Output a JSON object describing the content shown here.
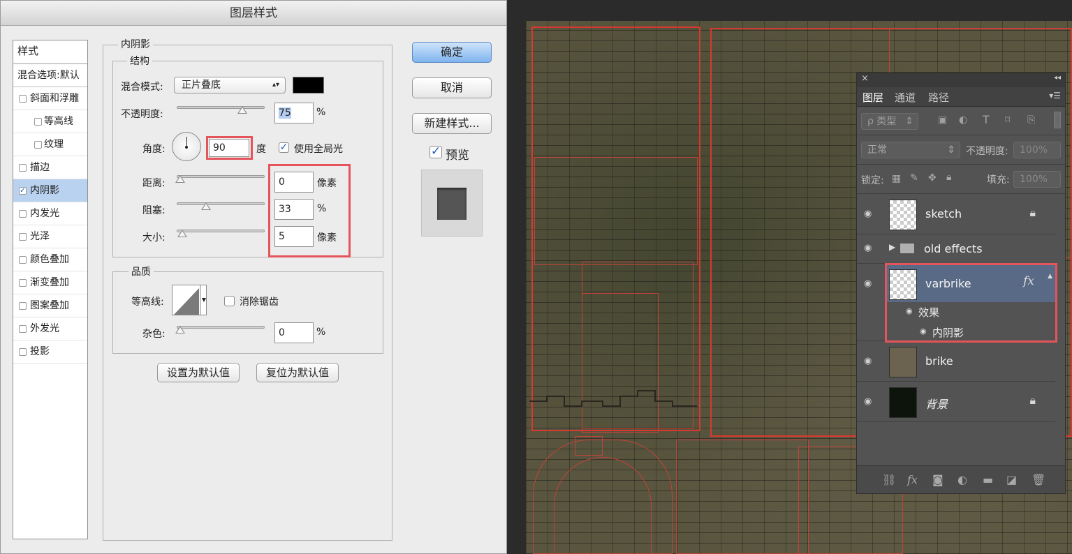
{
  "dialog": {
    "title": "图层样式",
    "style_list": {
      "header": "样式",
      "blend": "混合选项:默认",
      "items": [
        {
          "label": "斜面和浮雕",
          "checked": false,
          "sub": false
        },
        {
          "label": "等高线",
          "checked": false,
          "sub": true
        },
        {
          "label": "纹理",
          "checked": false,
          "sub": true
        },
        {
          "label": "描边",
          "checked": false,
          "sub": false
        },
        {
          "label": "内阴影",
          "checked": true,
          "sub": false
        },
        {
          "label": "内发光",
          "checked": false,
          "sub": false
        },
        {
          "label": "光泽",
          "checked": false,
          "sub": false
        },
        {
          "label": "颜色叠加",
          "checked": false,
          "sub": false
        },
        {
          "label": "渐变叠加",
          "checked": false,
          "sub": false
        },
        {
          "label": "图案叠加",
          "checked": false,
          "sub": false
        },
        {
          "label": "外发光",
          "checked": false,
          "sub": false
        },
        {
          "label": "投影",
          "checked": false,
          "sub": false
        }
      ]
    },
    "inner_shadow": {
      "title": "内阴影",
      "structure": {
        "title": "结构",
        "blend_mode_label": "混合模式:",
        "blend_mode_value": "正片叠底",
        "shadow_color": "#000000",
        "opacity_label": "不透明度:",
        "opacity_value": "75",
        "opacity_unit": "%",
        "opacity_fraction": 0.75,
        "angle_label": "角度:",
        "angle_value": "90",
        "angle_unit": "度",
        "global_light_label": "使用全局光",
        "global_light_checked": true,
        "distance_label": "距离:",
        "distance_value": "0",
        "distance_unit": "像素",
        "choke_label": "阻塞:",
        "choke_value": "33",
        "choke_unit": "%",
        "choke_fraction": 0.33,
        "size_label": "大小:",
        "size_value": "5",
        "size_unit": "像素"
      },
      "quality": {
        "title": "品质",
        "contour_label": "等高线:",
        "antialias_label": "消除锯齿",
        "antialias_checked": false,
        "noise_label": "杂色:",
        "noise_value": "0",
        "noise_unit": "%"
      },
      "set_default": "设置为默认值",
      "reset_default": "复位为默认值"
    },
    "buttons": {
      "ok": "确定",
      "cancel": "取消",
      "new_style": "新建样式...",
      "preview": "预览",
      "preview_checked": true
    }
  },
  "layers_panel": {
    "close_glyph": "×",
    "collapse_glyph": "◂◂",
    "tabs": [
      "图层",
      "通道",
      "路径"
    ],
    "menu_glyph": "▾☰",
    "filter_label": "ρ 类型",
    "blend_mode": "正常",
    "opacity_label": "不透明度:",
    "opacity_value": "100%",
    "lock_label": "锁定:",
    "fill_label": "填充:",
    "fill_value": "100%",
    "layers": [
      {
        "name": "sketch",
        "locked": true
      },
      {
        "name": "old effects",
        "type": "group"
      },
      {
        "name": "varbrike",
        "selected": true,
        "has_fx": true
      },
      {
        "name": "brike"
      },
      {
        "name": "背景",
        "locked": true
      }
    ],
    "effects_label": "效果",
    "effect_item": "内阴影",
    "fx_glyph": "fx"
  },
  "colors": {
    "highlight_red": "#e4545a",
    "panel_bg": "#535353",
    "selected_row": "#586a85"
  }
}
